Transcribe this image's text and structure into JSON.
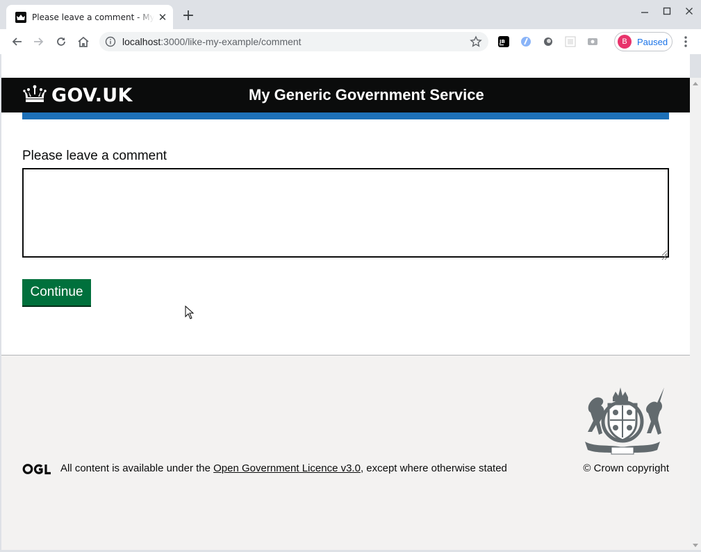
{
  "browser": {
    "tab_title": "Please leave a comment - My Generic Government Service",
    "url_host": "localhost",
    "url_path": ":3000/like-my-example/comment",
    "profile_initial": "B",
    "profile_status": "Paused",
    "icons": {
      "back": "arrow-left",
      "forward": "arrow-right",
      "reload": "reload",
      "home": "home",
      "site_info": "info",
      "bookmark": "star",
      "menu": "kebab"
    }
  },
  "header": {
    "logo_text": "GOV.UK",
    "service_name": "My Generic Government Service"
  },
  "form": {
    "label": "Please leave a comment",
    "comment_value": "",
    "submit_label": "Continue"
  },
  "footer": {
    "licence_prefix": "All content is available under the ",
    "licence_link": "Open Government Licence v3.0",
    "licence_suffix": ", except where otherwise stated",
    "copyright": "© Crown copyright"
  },
  "colors": {
    "header_bg": "#0b0c0c",
    "accent_blue": "#1d70b8",
    "button_green": "#00703c",
    "footer_bg": "#f3f2f1"
  }
}
